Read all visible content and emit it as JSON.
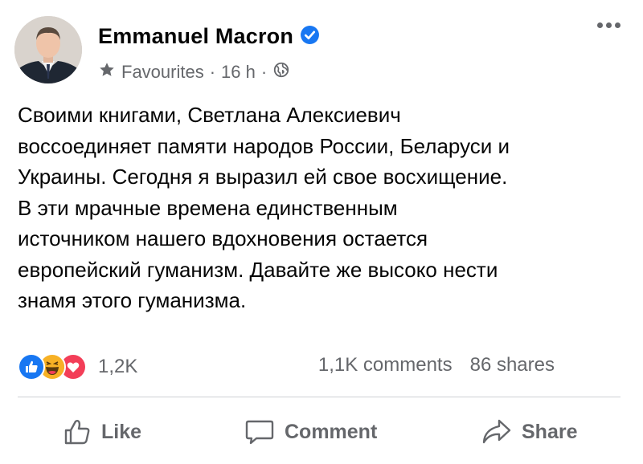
{
  "post": {
    "author": "Emmanuel Macron",
    "audience": "Favourites",
    "separator": "·",
    "time": "16 h",
    "text_lines": [
      "Своими книгами, Светлана Алексиевич",
      "воссоединяет памяти народов России, Беларуси и",
      "Украины. Сегодня я выразил ей свое восхищение.",
      "В эти мрачные времена единственным",
      "источником нашего вдохновения остается",
      "европейский гуманизм. Давайте же высоко нести",
      "знамя этого гуманизма."
    ]
  },
  "stats": {
    "reactions_count": "1,2K",
    "comments": "1,1K comments",
    "shares": "86 shares"
  },
  "actions": {
    "like": "Like",
    "comment": "Comment",
    "share": "Share"
  },
  "colors": {
    "text": "#050505",
    "secondary": "#65676b",
    "facebook_blue": "#1877f2",
    "love_red": "#f33e58",
    "haha_yellow": "#f7b125",
    "divider": "#ced0d4"
  }
}
